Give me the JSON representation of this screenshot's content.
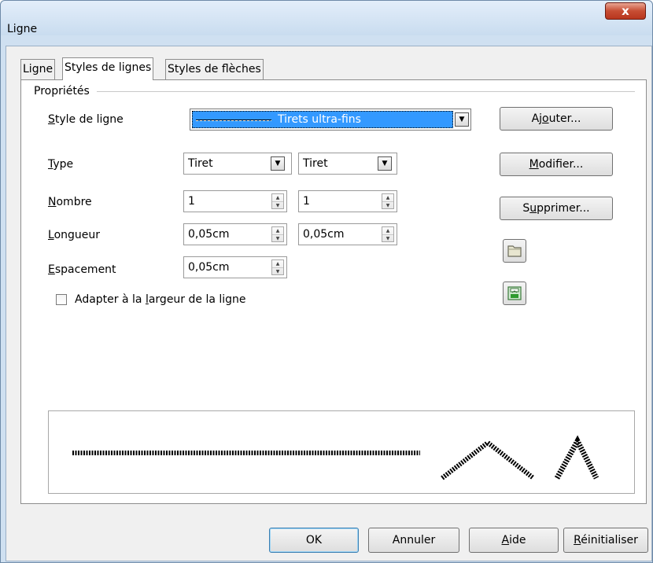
{
  "window": {
    "title": "Ligne",
    "close_label": "x"
  },
  "tabs": [
    {
      "label": "Ligne",
      "active": false
    },
    {
      "label": "Styles de lignes",
      "active": true
    },
    {
      "label": "Styles de flèches",
      "active": false
    }
  ],
  "properties": {
    "group_title": "Propriétés",
    "line_style": {
      "label_mnemonic": "S",
      "label_rest": "tyle de ligne",
      "value": "Tirets ultra-fins"
    },
    "type": {
      "label_mnemonic": "T",
      "label_rest": "ype",
      "value1": "Tiret",
      "value2": "Tiret"
    },
    "number": {
      "label_mnemonic": "N",
      "label_rest": "ombre",
      "value1": "1",
      "value2": "1"
    },
    "length": {
      "label_mnemonic": "L",
      "label_rest": "ongueur",
      "value1": "0,05cm",
      "value2": "0,05cm"
    },
    "spacing": {
      "label_mnemonic": "E",
      "label_rest": "spacement",
      "value": "0,05cm"
    },
    "fit_checkbox": {
      "label_pre": "Adapter à la ",
      "label_mnemonic": "l",
      "label_post": "argeur de la ligne",
      "checked": false
    }
  },
  "side_buttons": {
    "add": {
      "pre": "Aj",
      "mnemonic": "o",
      "post": "uter..."
    },
    "modify": {
      "pre": "",
      "mnemonic": "M",
      "post": "odifier..."
    },
    "delete": {
      "pre": "S",
      "mnemonic": "u",
      "post": "pprimer..."
    },
    "load_icon": "folder-open-icon",
    "save_icon": "save-line-styles-icon"
  },
  "footer": {
    "ok": "OK",
    "cancel": "Annuler",
    "help": {
      "mnemonic": "A",
      "rest": "ide"
    },
    "reset": {
      "mnemonic": "R",
      "rest": "éinitialiser"
    }
  },
  "colors": {
    "selection": "#3399ff",
    "titlebar": "#cfe0f1",
    "close_button": "#c74d33"
  }
}
